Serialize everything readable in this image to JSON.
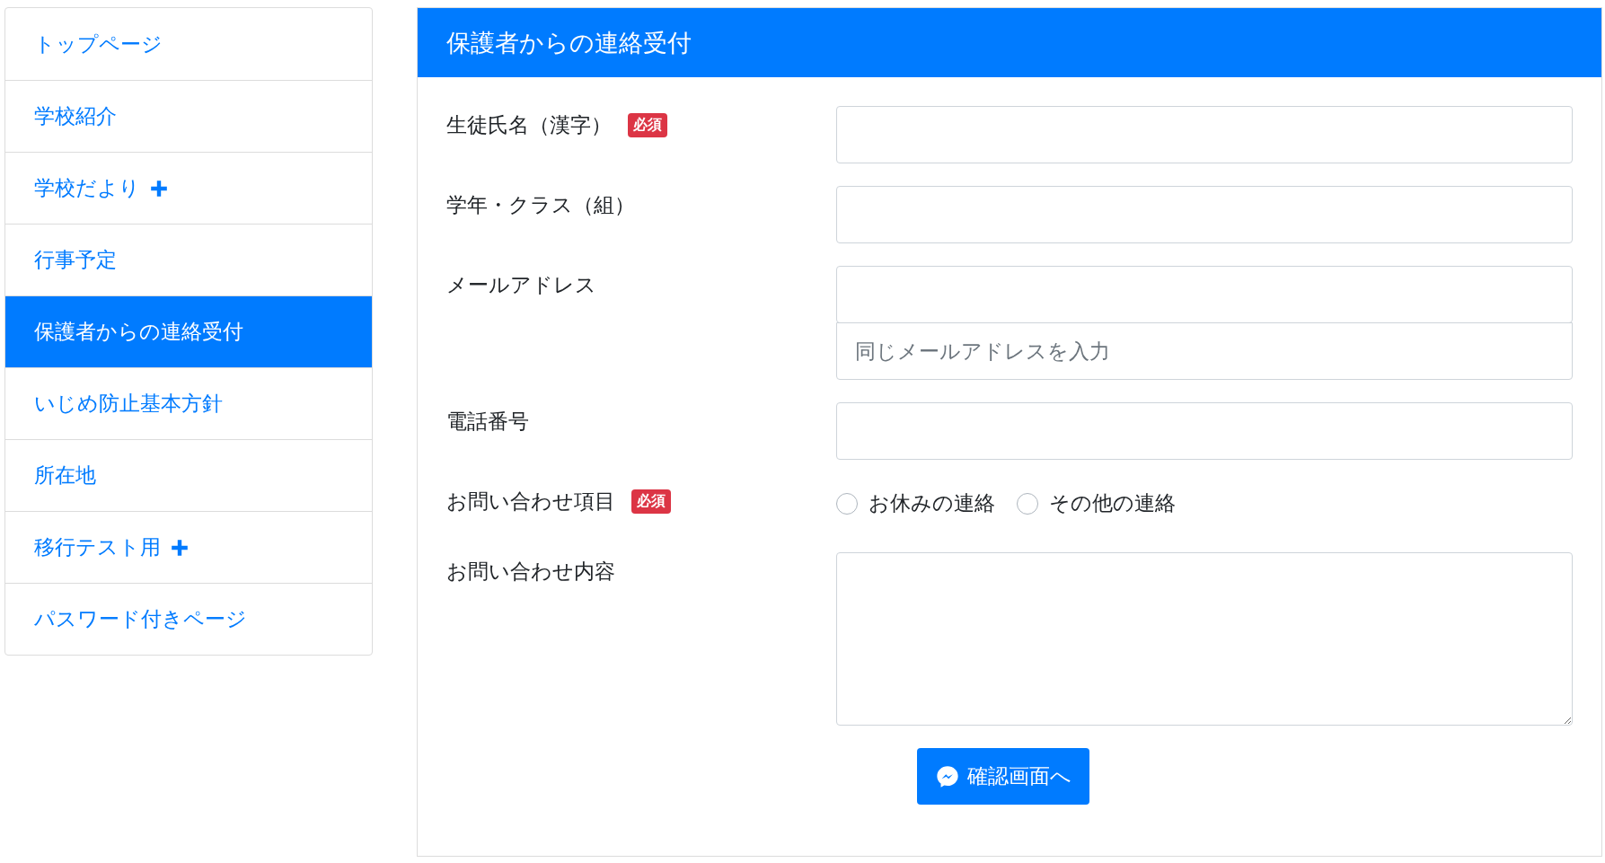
{
  "sidebar": {
    "items": [
      {
        "label": "トップページ",
        "selected": false,
        "expandable": false
      },
      {
        "label": "学校紹介",
        "selected": false,
        "expandable": false
      },
      {
        "label": "学校だより",
        "selected": false,
        "expandable": true
      },
      {
        "label": "行事予定",
        "selected": false,
        "expandable": false
      },
      {
        "label": "保護者からの連絡受付",
        "selected": true,
        "expandable": false
      },
      {
        "label": "いじめ防止基本方針",
        "selected": false,
        "expandable": false
      },
      {
        "label": "所在地",
        "selected": false,
        "expandable": false
      },
      {
        "label": "移行テスト用",
        "selected": false,
        "expandable": true
      },
      {
        "label": "パスワード付きページ",
        "selected": false,
        "expandable": false
      }
    ]
  },
  "form": {
    "title": "保護者からの連絡受付",
    "fields": [
      {
        "kind": "text",
        "label": "生徒氏名（漢字）",
        "badge": "必須"
      },
      {
        "kind": "text",
        "label": "学年・クラス（組）"
      },
      {
        "kind": "email",
        "label": "メールアドレス",
        "confirm_placeholder": "同じメールアドレスを入力"
      },
      {
        "kind": "text",
        "label": "電話番号"
      },
      {
        "kind": "radio",
        "label": "お問い合わせ項目",
        "badge": "必須",
        "options": [
          {
            "label": "お休みの連絡",
            "selected": false
          },
          {
            "label": "その他の連絡",
            "selected": false
          }
        ]
      },
      {
        "kind": "textarea",
        "label": "お問い合わせ内容"
      }
    ],
    "submit": "確認画面へ"
  }
}
